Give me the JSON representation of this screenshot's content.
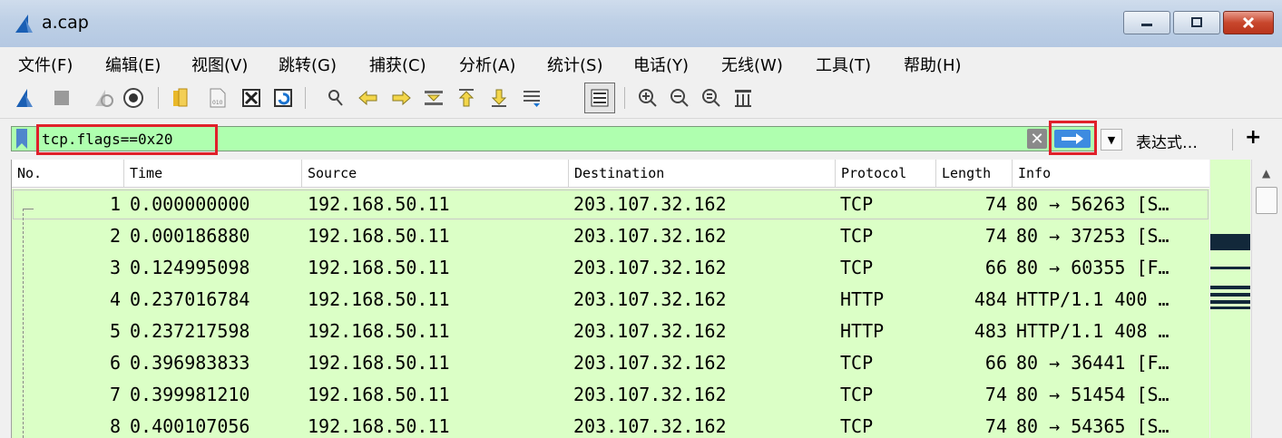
{
  "window": {
    "title": "a.cap",
    "icon": "wireshark-fin-icon",
    "controls": [
      "minimize-icon",
      "maximize-icon",
      "close-icon"
    ]
  },
  "menu": [
    "文件(F)",
    "编辑(E)",
    "视图(V)",
    "跳转(G)",
    "捕获(C)",
    "分析(A)",
    "统计(S)",
    "电话(Y)",
    "无线(W)",
    "工具(T)",
    "帮助(H)"
  ],
  "toolbar": {
    "icons": [
      "start-capture-icon",
      "stop-capture-icon",
      "restart-capture-icon",
      "capture-options-icon",
      "open-file-icon",
      "save-file-icon",
      "close-file-icon",
      "reload-file-icon",
      "find-packet-icon",
      "go-back-icon",
      "go-forward-icon",
      "go-to-packet-icon",
      "first-packet-icon",
      "last-packet-icon",
      "auto-scroll-icon",
      "colorize-icon",
      "zoom-in-icon",
      "zoom-out-icon",
      "normal-size-icon",
      "resize-columns-icon"
    ]
  },
  "filter": {
    "value": "tcp.flags==0x20",
    "expression_label": "表达式…",
    "plus_label": "+",
    "highlight_color": "#e0202a",
    "valid_bg": "#afffaf"
  },
  "packet_list": {
    "columns": [
      "No.",
      "Time",
      "Source",
      "Destination",
      "Protocol",
      "Length",
      "Info"
    ],
    "row_color": "#dbffc6",
    "rows": [
      {
        "no": "1",
        "time": "0.000000000",
        "source": "192.168.50.11",
        "destination": "203.107.32.162",
        "protocol": "TCP",
        "length": "74",
        "info": "80 → 56263 [S…"
      },
      {
        "no": "2",
        "time": "0.000186880",
        "source": "192.168.50.11",
        "destination": "203.107.32.162",
        "protocol": "TCP",
        "length": "74",
        "info": "80 → 37253 [S…"
      },
      {
        "no": "3",
        "time": "0.124995098",
        "source": "192.168.50.11",
        "destination": "203.107.32.162",
        "protocol": "TCP",
        "length": "66",
        "info": "80 → 60355 [F…"
      },
      {
        "no": "4",
        "time": "0.237016784",
        "source": "192.168.50.11",
        "destination": "203.107.32.162",
        "protocol": "HTTP",
        "length": "484",
        "info": "HTTP/1.1 400 …"
      },
      {
        "no": "5",
        "time": "0.237217598",
        "source": "192.168.50.11",
        "destination": "203.107.32.162",
        "protocol": "HTTP",
        "length": "483",
        "info": "HTTP/1.1 408 …"
      },
      {
        "no": "6",
        "time": "0.396983833",
        "source": "192.168.50.11",
        "destination": "203.107.32.162",
        "protocol": "TCP",
        "length": "66",
        "info": "80 → 36441 [F…"
      },
      {
        "no": "7",
        "time": "0.399981210",
        "source": "192.168.50.11",
        "destination": "203.107.32.162",
        "protocol": "TCP",
        "length": "74",
        "info": "80 → 51454 [S…"
      },
      {
        "no": "8",
        "time": "0.400107056",
        "source": "192.168.50.11",
        "destination": "203.107.32.162",
        "protocol": "TCP",
        "length": "74",
        "info": "80 → 54365 [S…"
      }
    ]
  }
}
